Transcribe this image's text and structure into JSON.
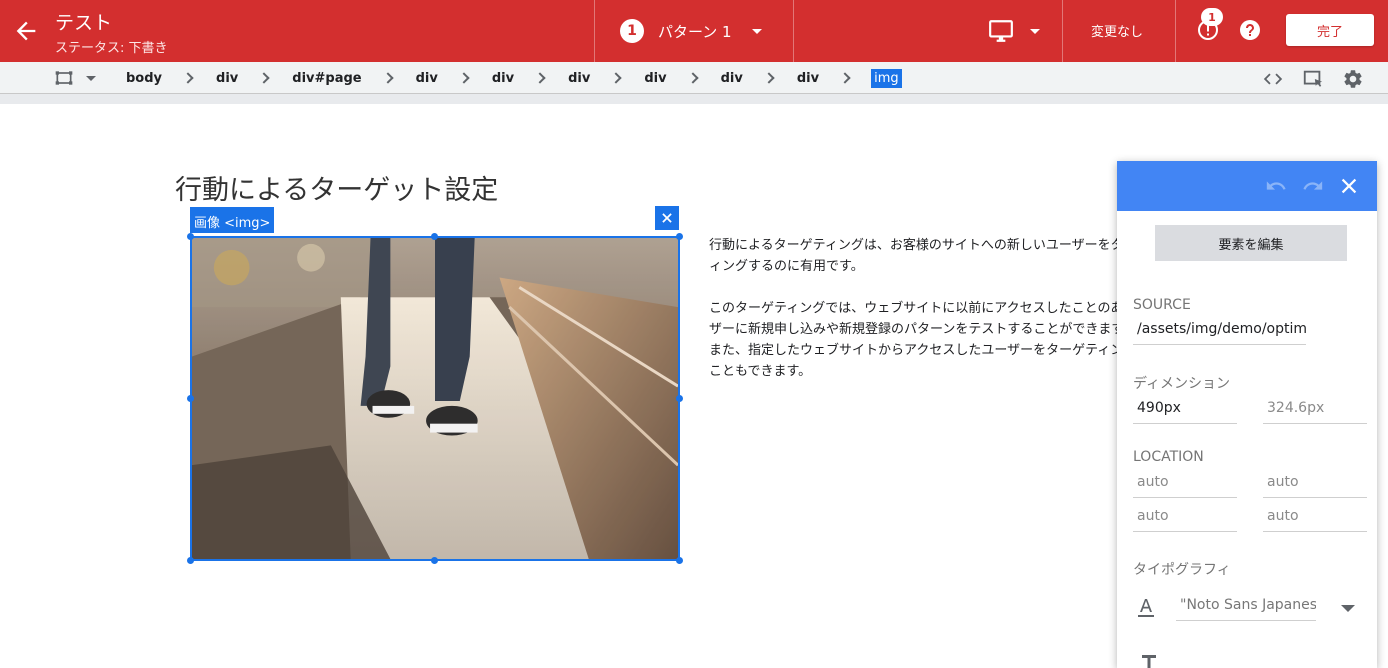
{
  "appbar": {
    "title": "テスト",
    "status": "ステータス: 下書き",
    "pattern_number": "1",
    "pattern_label": "パターン 1",
    "change_status": "変更なし",
    "warning_count": "1",
    "done_label": "完了",
    "bg_color": "#d32f2f"
  },
  "breadcrumb": {
    "items": [
      "body",
      "div",
      "div#page",
      "div",
      "div",
      "div",
      "div",
      "div",
      "div",
      "img"
    ],
    "active_index": 9
  },
  "content": {
    "heading": "行動によるターゲット設定",
    "image_tag": "画像 <img>",
    "para1": [
      "行動によるターゲティングは、お客様のサイトへの新しいユーザーをターゲ",
      "ィングするのに有用です。"
    ],
    "para2": [
      "このターゲティングでは、ウェブサイトに以前にアクセスしたことのあるユー",
      "ザーに新規申し込みや新規登録のパターンをテストすることができます。",
      "また、指定したウェブサイトからアクセスしたユーザーをターゲティングする",
      "こともできます。"
    ]
  },
  "panel": {
    "edit_label": "要素を編集",
    "source_label": "SOURCE",
    "source_value": "/assets/img/demo/optimize-behavior.jpg",
    "dimension_label": "ディメンション",
    "width_value": "490px",
    "height_placeholder": "324.6px",
    "location_label": "LOCATION",
    "location_values": [
      "auto",
      "auto",
      "auto",
      "auto"
    ],
    "typography_label": "タイポグラフィ",
    "font_value": "\"Noto Sans Japanese\"",
    "header_color": "#4285f4"
  },
  "icons": {
    "back": "arrow-back-icon",
    "device": "desktop-icon",
    "warning": "alert-icon",
    "help": "help-icon",
    "select_tool": "selection-box-icon",
    "code": "code-icon",
    "select_element": "select-element-icon",
    "settings": "gear-icon",
    "undo": "undo-icon",
    "redo": "redo-icon",
    "close": "close-icon",
    "font": "text-color-icon",
    "font_size": "text-size-icon"
  }
}
